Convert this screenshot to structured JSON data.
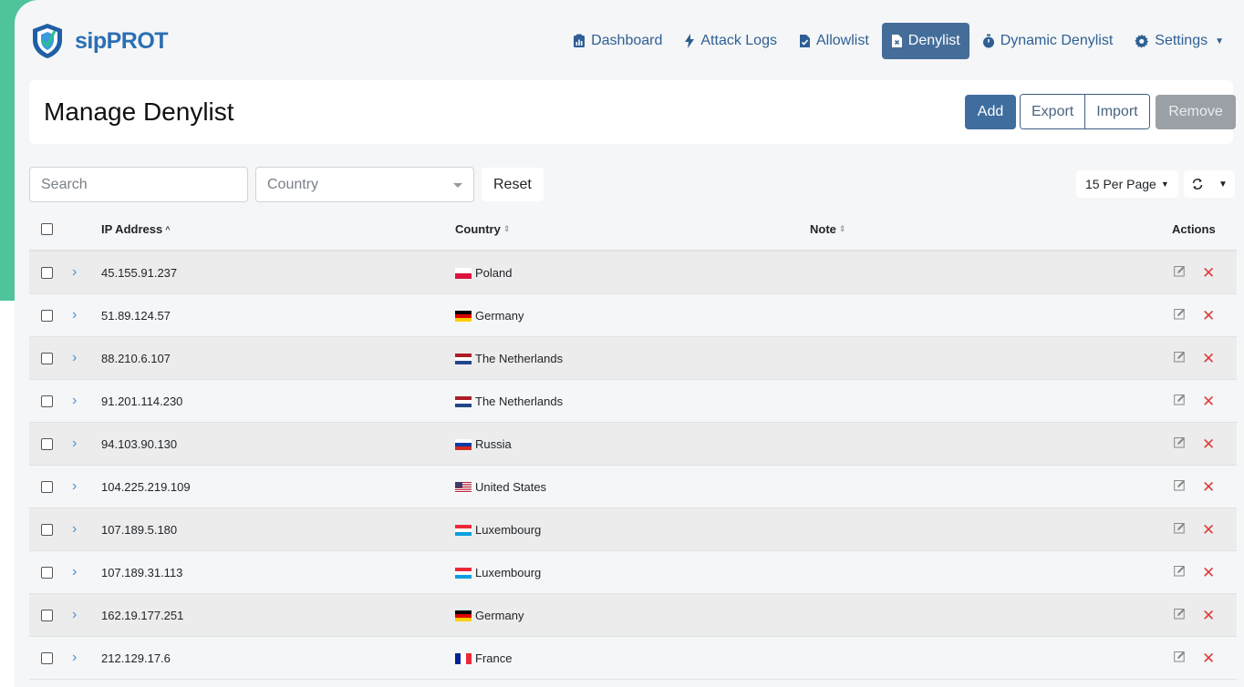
{
  "app": {
    "name": "sipPROT"
  },
  "nav": {
    "items": [
      {
        "label": "Dashboard",
        "icon": "clipboard-chart-icon"
      },
      {
        "label": "Attack Logs",
        "icon": "bolt-icon"
      },
      {
        "label": "Allowlist",
        "icon": "file-check-icon"
      },
      {
        "label": "Denylist",
        "icon": "file-x-icon",
        "active": true
      },
      {
        "label": "Dynamic Denylist",
        "icon": "stopwatch-icon"
      },
      {
        "label": "Settings",
        "icon": "gear-icon"
      }
    ]
  },
  "header": {
    "title": "Manage Denylist",
    "add": "Add",
    "export": "Export",
    "import": "Import",
    "remove": "Remove"
  },
  "filters": {
    "search_placeholder": "Search",
    "country_placeholder": "Country",
    "reset": "Reset",
    "per_page": "15 Per Page"
  },
  "table": {
    "headers": {
      "ip": "IP Address",
      "country": "Country",
      "note": "Note",
      "actions": "Actions"
    },
    "rows": [
      {
        "ip": "45.155.91.237",
        "country": "Poland",
        "flag": "pl"
      },
      {
        "ip": "51.89.124.57",
        "country": "Germany",
        "flag": "de"
      },
      {
        "ip": "88.210.6.107",
        "country": "The Netherlands",
        "flag": "nl"
      },
      {
        "ip": "91.201.114.230",
        "country": "The Netherlands",
        "flag": "nl"
      },
      {
        "ip": "94.103.90.130",
        "country": "Russia",
        "flag": "ru"
      },
      {
        "ip": "104.225.219.109",
        "country": "United States",
        "flag": "us"
      },
      {
        "ip": "107.189.5.180",
        "country": "Luxembourg",
        "flag": "lu"
      },
      {
        "ip": "107.189.31.113",
        "country": "Luxembourg",
        "flag": "lu"
      },
      {
        "ip": "162.19.177.251",
        "country": "Germany",
        "flag": "de"
      },
      {
        "ip": "212.129.17.6",
        "country": "France",
        "flag": "fr"
      }
    ]
  },
  "colors": {
    "accent": "#4fc39a",
    "brand": "#2b6fb3",
    "primary": "#3f6d9e",
    "danger": "#e03c3c"
  }
}
